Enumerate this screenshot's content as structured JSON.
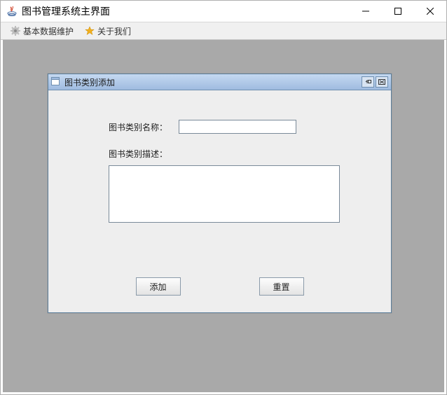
{
  "window": {
    "title": "图书管理系统主界面"
  },
  "menubar": {
    "items": [
      {
        "label": "基本数据维护",
        "icon": "gear-icon"
      },
      {
        "label": "关于我们",
        "icon": "star-icon"
      }
    ]
  },
  "internalFrame": {
    "title": "图书类别添加",
    "form": {
      "name_label": "图书类别名称：",
      "name_value": "",
      "desc_label": "图书类别描述：",
      "desc_value": ""
    },
    "buttons": {
      "add_label": "添加",
      "reset_label": "重置"
    }
  }
}
